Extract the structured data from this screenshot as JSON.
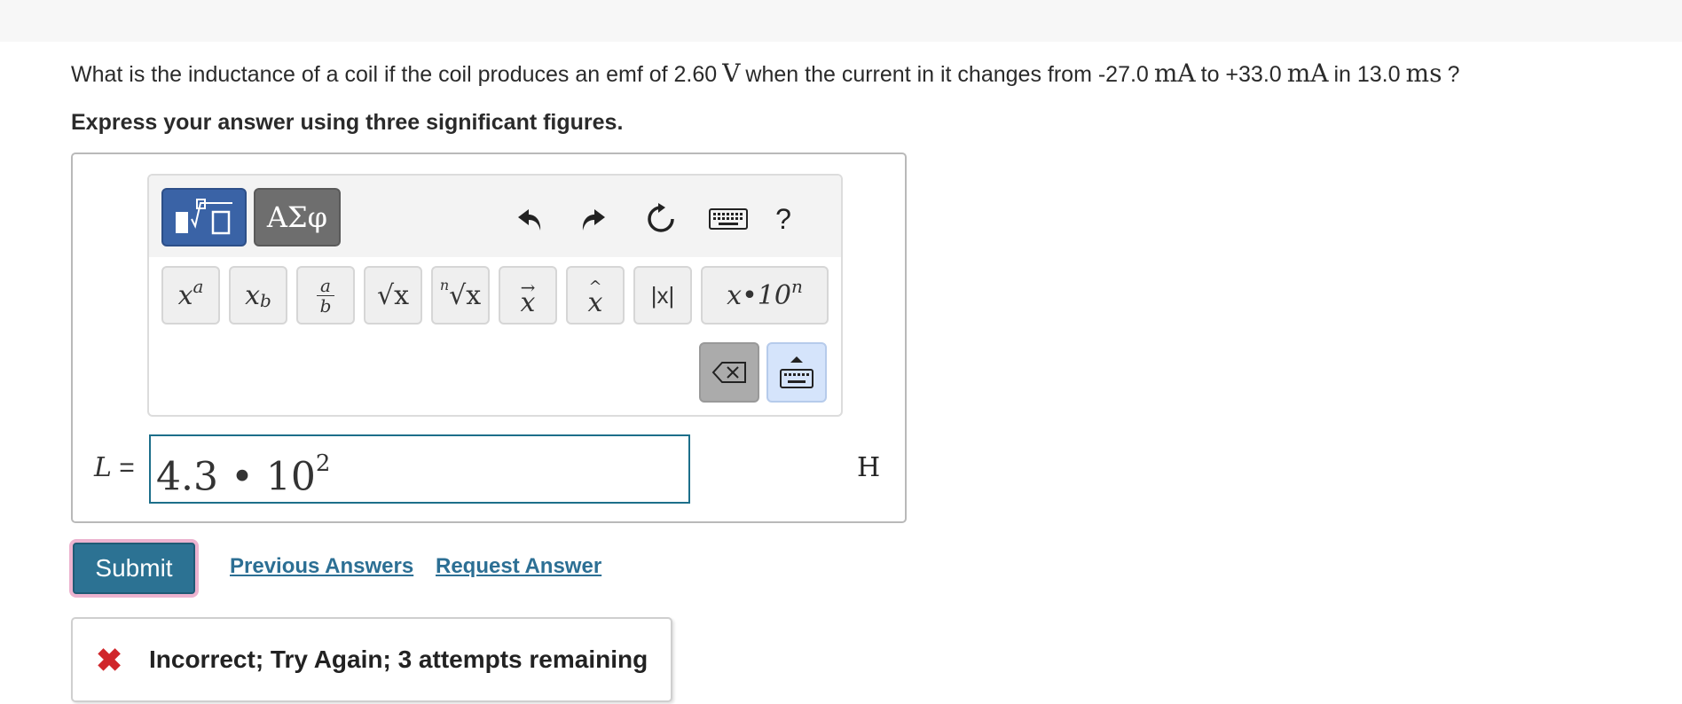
{
  "question": {
    "part1": "What is the inductance of a coil if the coil produces an emf of 2.60",
    "unit_emf": "V",
    "part2": "when the current in it changes from -27.0",
    "unit_current1": "mA",
    "part3": "to +33.0",
    "unit_current2": "mA",
    "part4": "in 13.0",
    "unit_time": "ms",
    "part5": "?"
  },
  "instruction": "Express your answer using three significant figures.",
  "toolbar": {
    "greek_label": "ΑΣφ",
    "help_label": "?",
    "keys": {
      "power_base": "x",
      "power_exp": "a",
      "sub_base": "x",
      "sub_exp": "b",
      "frac_num": "a",
      "frac_den": "b",
      "sqrt_label": "√x",
      "nroot_index": "n",
      "nroot_label": "√x",
      "vector_label": "x",
      "hat_label": "x",
      "abs_label": "|x|",
      "sci_label": "x•10",
      "sci_exp": "n"
    }
  },
  "equation": {
    "variable": "L",
    "equals": "=",
    "input_mantissa": "4.3 • 10",
    "input_exp": "2",
    "unit": "H"
  },
  "actions": {
    "submit_label": "Submit",
    "previous_answers_label": "Previous Answers",
    "request_answer_label": "Request Answer"
  },
  "feedback": {
    "icon": "✖",
    "message": "Incorrect; Try Again; 3 attempts remaining"
  },
  "colors": {
    "submit_bg": "#2c7293",
    "submit_focus_ring": "#ecb3cf",
    "link": "#2c6f94",
    "incorrect_icon": "#d0262b",
    "templates_button": "#3a63a6",
    "greek_button": "#6e6e6e"
  }
}
